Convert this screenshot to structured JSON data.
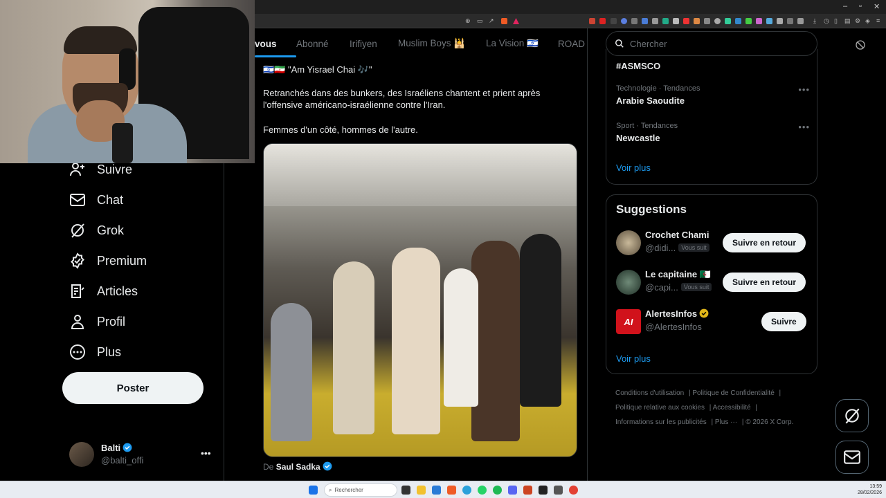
{
  "tabs": [
    "vous",
    "Abonné",
    "Irifiyen",
    "Muslim Boys 🕌",
    "La Vision 🇮🇱",
    "ROAD"
  ],
  "nav": {
    "items": [
      {
        "label": "Suivre",
        "icon": "follow-icon"
      },
      {
        "label": "Chat",
        "icon": "mail-icon"
      },
      {
        "label": "Grok",
        "icon": "grok-icon"
      },
      {
        "label": "Premium",
        "icon": "premium-icon"
      },
      {
        "label": "Articles",
        "icon": "articles-icon"
      },
      {
        "label": "Profil",
        "icon": "profile-icon"
      },
      {
        "label": "Plus",
        "icon": "more-icon"
      }
    ],
    "post_label": "Poster"
  },
  "account": {
    "name": "Balti",
    "handle": "@balti_offi"
  },
  "tweet": {
    "line1": "🇮🇱🇮🇷 \"Am Yisrael Chai 🎶\"",
    "line2": "Retranchés dans des bunkers, des Israéliens chantent et prient après l'offensive américano-israélienne contre l'Iran.",
    "line3": "Femmes d'un côté, hommes de l'autre.",
    "from_prefix": "De",
    "from_name": "Saul Sadka"
  },
  "search": {
    "placeholder": "Chercher"
  },
  "trends": {
    "top_name": "#ASMSCO",
    "items": [
      {
        "meta": "Technologie · Tendances",
        "name": "Arabie Saoudite"
      },
      {
        "meta": "Sport · Tendances",
        "name": "Newcastle"
      }
    ],
    "show_more": "Voir plus"
  },
  "suggestions": {
    "title": "Suggestions",
    "items": [
      {
        "name": "Crochet Chami",
        "handle": "@didi...",
        "badge": "Vous suit",
        "button": "Suivre en retour",
        "avatar_color": "#8a7f6a"
      },
      {
        "name": "Le capitaine 🇩🇿",
        "handle": "@capi...",
        "badge": "Vous suit",
        "button": "Suivre en retour",
        "avatar_color": "#3d5a48"
      },
      {
        "name": "AlertesInfos",
        "handle": "@AlertesInfos",
        "badge": "",
        "button": "Suivre",
        "avatar_color": "#d1121b"
      }
    ],
    "show_more": "Voir plus"
  },
  "footer": {
    "links": [
      "Conditions d'utilisation",
      "Politique de Confidentialité",
      "Politique relative aux cookies",
      "Accessibilité",
      "Informations sur les publicités",
      "Plus ···"
    ],
    "copyright": "© 2026 X Corp."
  },
  "taskbar": {
    "search_label": "Rechercher",
    "time": "13:59",
    "date": "28/02/2026"
  },
  "colors": {
    "accent": "#1d9bf0",
    "background": "#000000",
    "muted": "#71767b"
  }
}
